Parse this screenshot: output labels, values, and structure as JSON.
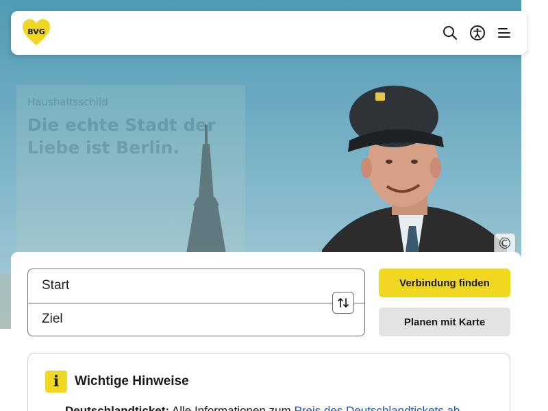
{
  "header": {
    "logo_text": "BVG",
    "brand_color": "#f0d722",
    "icons": [
      "search-icon",
      "accessibility-icon",
      "menu-icon"
    ]
  },
  "hero": {
    "kicker": "Haushaltsschild",
    "headline": "Die echte Stadt der Liebe ist Berlin.",
    "copyright_symbol": "©"
  },
  "search": {
    "start_placeholder": "Start",
    "destination_placeholder": "Ziel",
    "swap_icon": "swap-icon",
    "find_button": "Verbindung finden",
    "map_button": "Planen mit Karte"
  },
  "notice": {
    "title": "Wichtige Hinweise",
    "icon": "info-icon",
    "info_glyph": "i",
    "item_label": "Deutschlandticket:",
    "item_text": " Alle Informationen zum ",
    "item_link": "Preis des Deutschlandtickets ab"
  }
}
